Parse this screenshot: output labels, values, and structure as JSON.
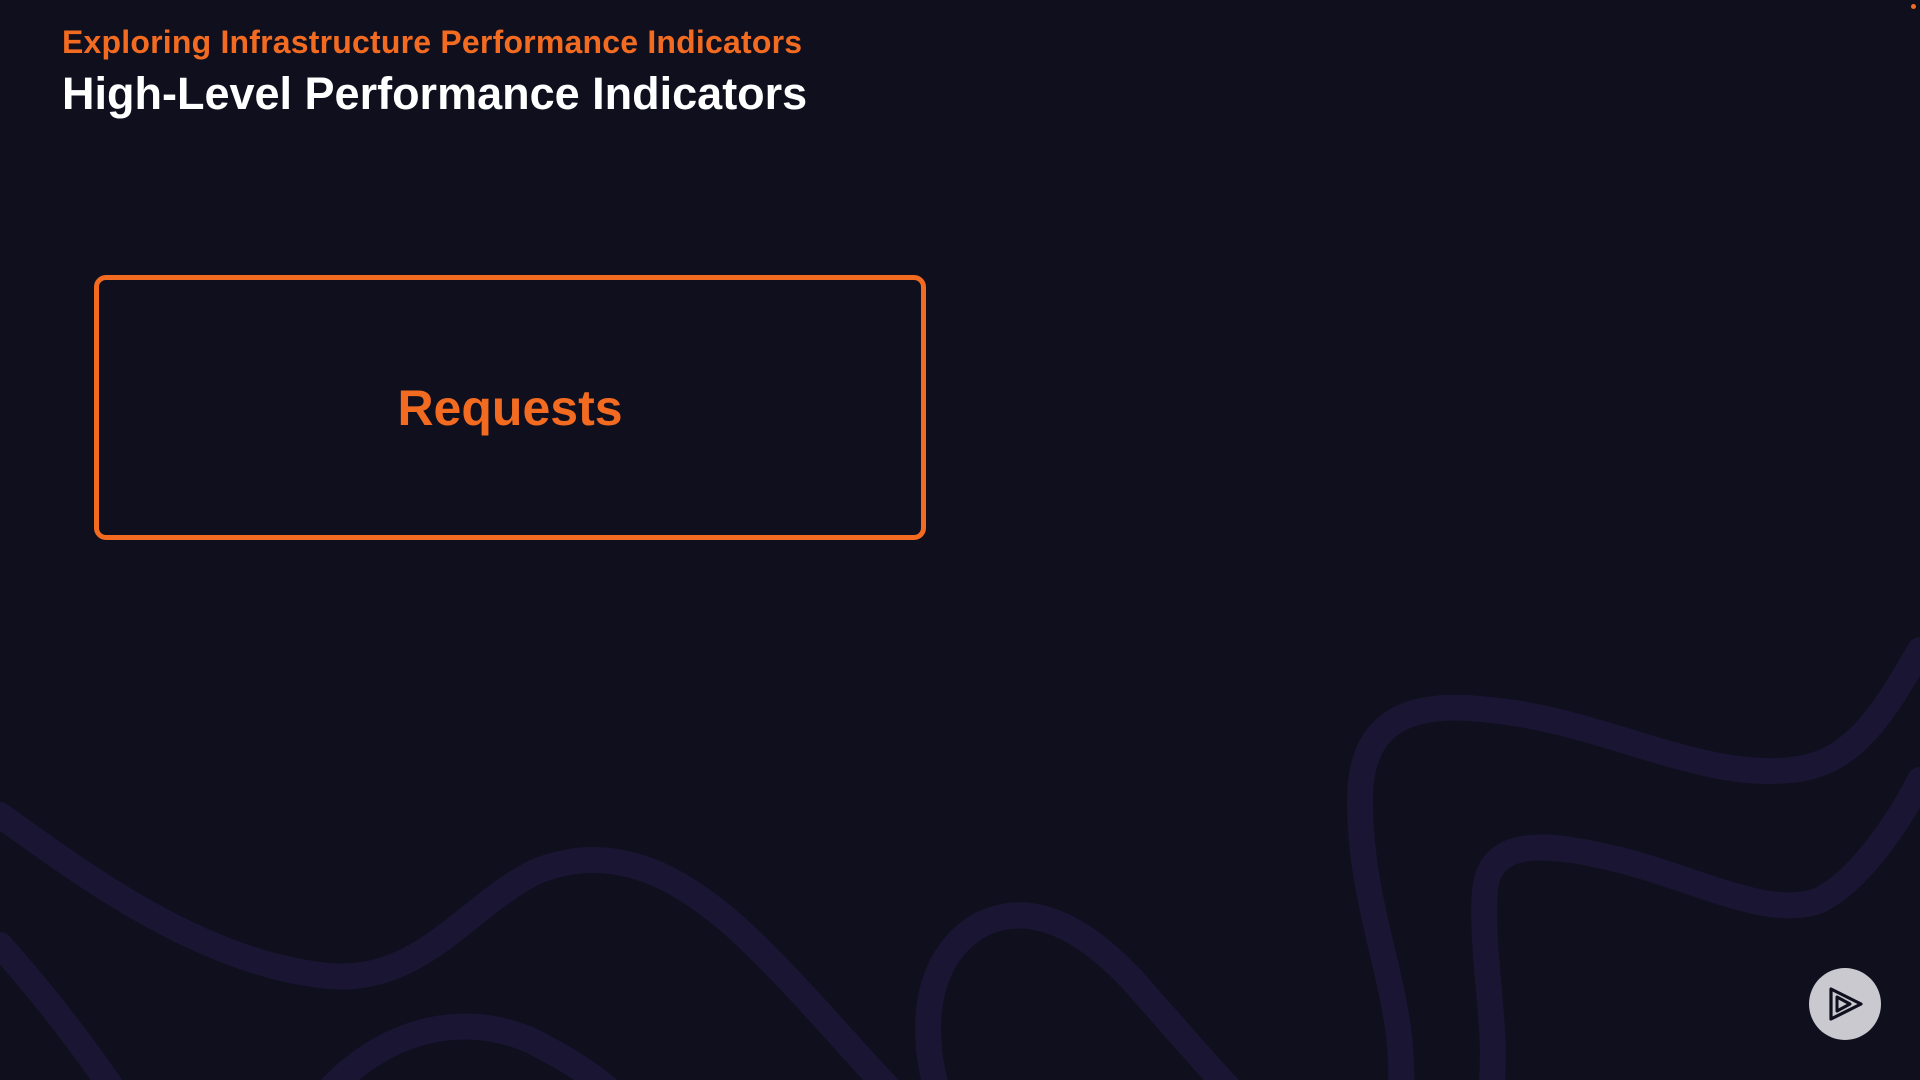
{
  "header": {
    "subtitle": "Exploring Infrastructure Performance Indicators",
    "title": "High-Level Performance Indicators"
  },
  "cards": [
    {
      "label": "Requests"
    }
  ],
  "branding": {
    "logo_icon": "play-logo-icon"
  },
  "colors": {
    "background": "#0f0f1e",
    "accent": "#f26b21",
    "title": "#ffffff",
    "wave": "#1a1533"
  }
}
